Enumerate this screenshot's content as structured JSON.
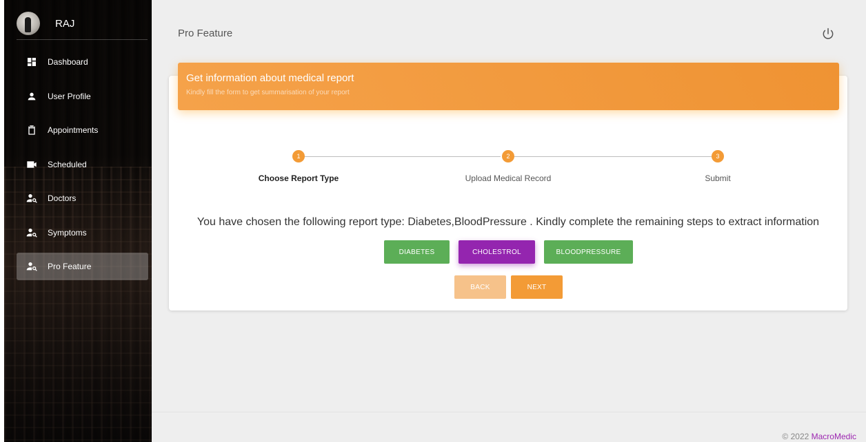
{
  "user": {
    "name": "RAJ"
  },
  "sidebar": {
    "items": [
      {
        "label": "Dashboard",
        "icon": "dashboard-icon"
      },
      {
        "label": "User Profile",
        "icon": "person-icon"
      },
      {
        "label": "Appointments",
        "icon": "clipboard-icon"
      },
      {
        "label": "Scheduled",
        "icon": "video-camera-icon"
      },
      {
        "label": "Doctors",
        "icon": "person-search-icon"
      },
      {
        "label": "Symptoms",
        "icon": "person-search-icon"
      },
      {
        "label": "Pro Feature",
        "icon": "person-search-icon",
        "active": true
      }
    ]
  },
  "header": {
    "title": "Pro Feature"
  },
  "card": {
    "title": "Get information about medical report",
    "subtitle": "Kindly fill the form to get summarisation of your report"
  },
  "stepper": {
    "steps": [
      {
        "number": "1",
        "label": "Choose Report Type",
        "active": true
      },
      {
        "number": "2",
        "label": "Upload Medical Record"
      },
      {
        "number": "3",
        "label": "Submit"
      }
    ]
  },
  "message": "You have chosen the following report type: Diabetes,BloodPressure . Kindly complete the remaining steps to extract information",
  "report_types": [
    {
      "label": "DIABETES",
      "color": "#5cae57"
    },
    {
      "label": "CHOLESTROL",
      "color": "#9425af"
    },
    {
      "label": "BLOODPRESSURE",
      "color": "#5cae57"
    }
  ],
  "actions": {
    "back": "BACK",
    "next": "NEXT"
  },
  "footer": {
    "copyright": "© 2022",
    "brand": "MacroMedic"
  },
  "colors": {
    "accent": "#f39b36",
    "selected": "#9425af",
    "unselected": "#5cae57"
  }
}
